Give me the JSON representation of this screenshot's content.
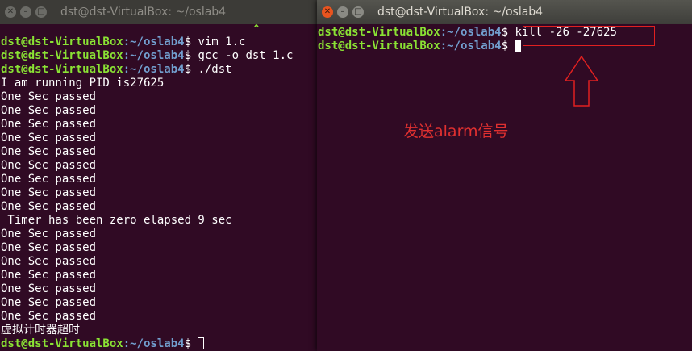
{
  "left_window": {
    "title": "dst@dst-VirtualBox: ~/oslab4",
    "caret": "^",
    "prompt_user": "dst@dst-VirtualBox",
    "prompt_path": ":~/oslab4",
    "prompt_symbol": "$ ",
    "lines": [
      {
        "kind": "prompt",
        "cmd": "vim 1.c"
      },
      {
        "kind": "prompt",
        "cmd": "gcc -o dst 1.c"
      },
      {
        "kind": "prompt",
        "cmd": "./dst"
      },
      {
        "kind": "out",
        "text": "I am running PID is27625"
      },
      {
        "kind": "out",
        "text": "One Sec passed"
      },
      {
        "kind": "out",
        "text": "One Sec passed"
      },
      {
        "kind": "out",
        "text": "One Sec passed"
      },
      {
        "kind": "out",
        "text": "One Sec passed"
      },
      {
        "kind": "out",
        "text": "One Sec passed"
      },
      {
        "kind": "out",
        "text": "One Sec passed"
      },
      {
        "kind": "out",
        "text": "One Sec passed"
      },
      {
        "kind": "out",
        "text": "One Sec passed"
      },
      {
        "kind": "out",
        "text": "One Sec passed"
      },
      {
        "kind": "out",
        "text": " Timer has been zero elapsed 9 sec"
      },
      {
        "kind": "out",
        "text": "One Sec passed"
      },
      {
        "kind": "out",
        "text": "One Sec passed"
      },
      {
        "kind": "out",
        "text": "One Sec passed"
      },
      {
        "kind": "out",
        "text": "One Sec passed"
      },
      {
        "kind": "out",
        "text": "One Sec passed"
      },
      {
        "kind": "out",
        "text": "One Sec passed"
      },
      {
        "kind": "out",
        "text": "One Sec passed"
      },
      {
        "kind": "out",
        "text": "虚拟计时器超时",
        "cjk": true
      },
      {
        "kind": "prompt",
        "cmd": "",
        "cursor": "hollow"
      }
    ]
  },
  "right_window": {
    "title": "dst@dst-VirtualBox: ~/oslab4",
    "prompt_user": "dst@dst-VirtualBox",
    "prompt_path": ":~/oslab4",
    "prompt_symbol": "$ ",
    "lines": [
      {
        "kind": "prompt",
        "cmd": "kill -26 -27625"
      },
      {
        "kind": "prompt",
        "cmd": "",
        "cursor": "block"
      }
    ]
  },
  "annotation": {
    "text": "发送alarm信号",
    "color": "#e03030"
  },
  "colors": {
    "background": "#300a24",
    "prompt_user": "#8ae234",
    "prompt_path": "#729fcf",
    "close_button": "#e9541f"
  }
}
